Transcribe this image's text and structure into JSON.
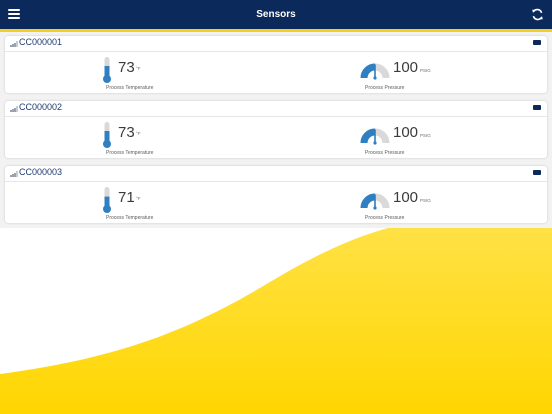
{
  "header": {
    "title": "Sensors",
    "menu_icon": "hamburger-menu-icon",
    "refresh_icon": "refresh-icon",
    "bar_color": "#0b2a5b",
    "accent_color": "#f5cf1f"
  },
  "sensors": [
    {
      "id": "CC000001",
      "temperature": {
        "value": "73",
        "unit": "°F",
        "label": "Process Temperature",
        "fill_fraction": 0.55
      },
      "pressure": {
        "value": "100",
        "unit": "PSIG",
        "label": "Process Pressure",
        "gauge_fraction": 0.5
      }
    },
    {
      "id": "CC000002",
      "temperature": {
        "value": "73",
        "unit": "°F",
        "label": "Process Temperature",
        "fill_fraction": 0.55
      },
      "pressure": {
        "value": "100",
        "unit": "PSIG",
        "label": "Process Pressure",
        "gauge_fraction": 0.5
      }
    },
    {
      "id": "CC000003",
      "temperature": {
        "value": "71",
        "unit": "°F",
        "label": "Process Temperature",
        "fill_fraction": 0.52
      },
      "pressure": {
        "value": "100",
        "unit": "PSIG",
        "label": "Process Pressure",
        "gauge_fraction": 0.5
      }
    }
  ],
  "colors": {
    "gauge_blue": "#2f7fc1",
    "gauge_gray": "#d9d9d9",
    "wave_yellow": "#ffe11a"
  }
}
